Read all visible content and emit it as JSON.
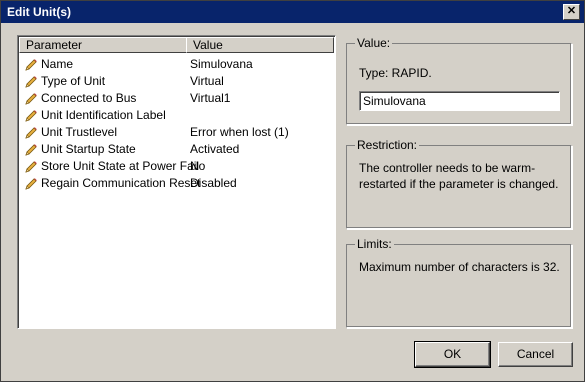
{
  "window": {
    "title": "Edit Unit(s)",
    "close_symbol": "✕"
  },
  "table": {
    "headers": {
      "parameter": "Parameter",
      "value": "Value"
    },
    "rows": [
      {
        "name": "Name",
        "value": "Simulovana"
      },
      {
        "name": "Type of Unit",
        "value": "Virtual"
      },
      {
        "name": "Connected to Bus",
        "value": "Virtual1"
      },
      {
        "name": "Unit Identification Label",
        "value": ""
      },
      {
        "name": "Unit Trustlevel",
        "value": "Error when lost (1)"
      },
      {
        "name": "Unit Startup State",
        "value": "Activated"
      },
      {
        "name": "Store Unit State at Power Fail",
        "value": "No"
      },
      {
        "name": "Regain Communication Reset",
        "value": "Disabled"
      }
    ]
  },
  "value_group": {
    "legend": "Value:",
    "type_text": "Type: RAPID.",
    "input_value": "Simulovana"
  },
  "restriction_group": {
    "legend": "Restriction:",
    "text": "The controller needs to be warm-restarted if the parameter is changed."
  },
  "limits_group": {
    "legend": "Limits:",
    "text": "Maximum number of characters is 32."
  },
  "buttons": {
    "ok": "OK",
    "cancel": "Cancel"
  },
  "icons": {
    "row_icon": "pencil-icon"
  }
}
